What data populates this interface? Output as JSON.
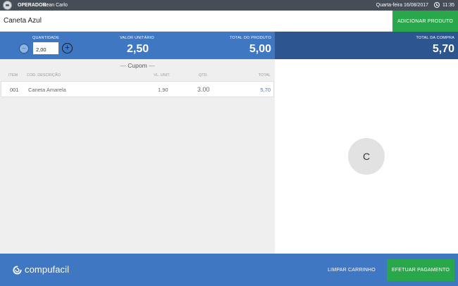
{
  "topbar": {
    "operator_label": "OPERADOR:",
    "operator_name": "Jean Carlo",
    "date": "Quarta-feira 16/08/2017",
    "time": "11:35"
  },
  "product": {
    "name": "Caneta Azul",
    "add_button": "ADICIONAR PRODUTO"
  },
  "infobar": {
    "quantity_label": "QUANTIDADE",
    "quantity_value": "2,00",
    "minus": "−",
    "plus": "+",
    "unit_label": "VALOR UNITÁRIO",
    "unit_value": "2,50",
    "total_product_label": "TOTAL DO PRODUTO",
    "total_product_value": "5,00",
    "total_purchase_label": "TOTAL DA COMPRA",
    "total_purchase_value": "5,70"
  },
  "receipt": {
    "title": "Cupom",
    "dash": "—",
    "headers": {
      "item": "ITEM",
      "code_desc": "COD. DESCRIÇÃO",
      "unit": "VL. UNIT.",
      "qty": "QTD.",
      "total": "TOTAL"
    },
    "rows": [
      {
        "item": "001",
        "description": "Caneta Amarela",
        "unit": "1,90",
        "qty": "3.00",
        "total": "5,70"
      }
    ]
  },
  "right": {
    "avatar_letter": "C"
  },
  "footer": {
    "brand": "compufacil",
    "clear_button": "LIMPAR CARRINHO",
    "pay_button": "EFETUAR PAGAMENTO"
  },
  "colors": {
    "primary_blue": "#3f77c2",
    "dark_blue": "#2d5691",
    "green": "#28a84a",
    "topbar": "#454d57"
  }
}
